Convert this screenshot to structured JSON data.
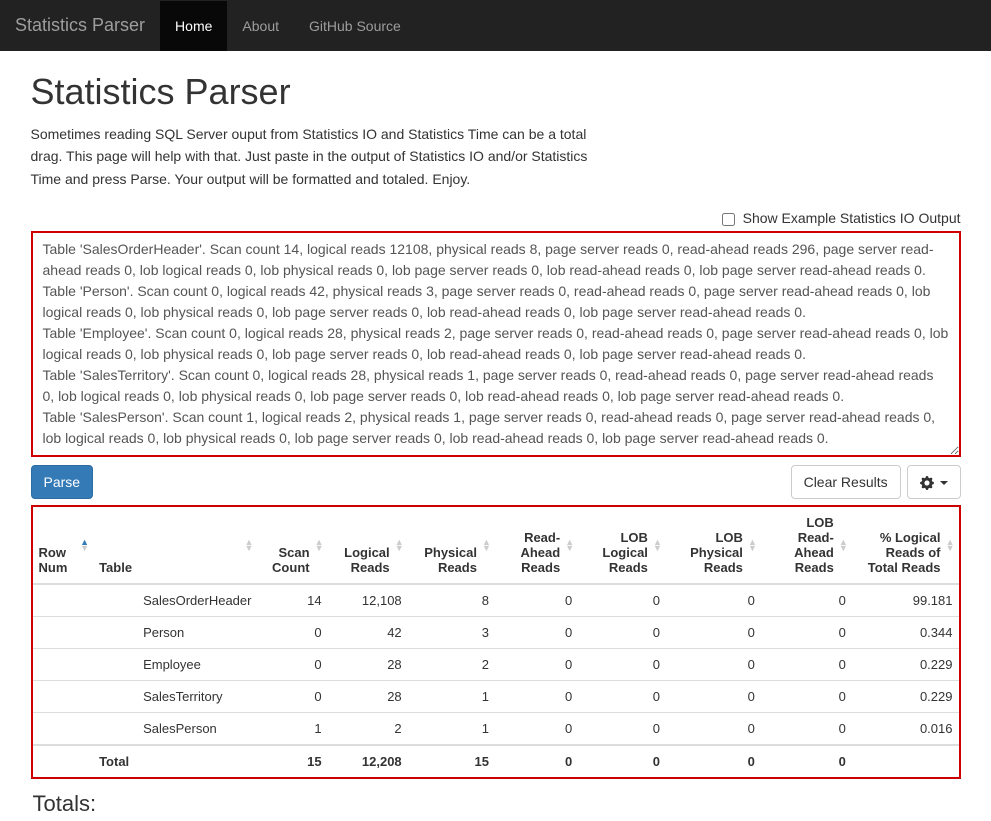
{
  "nav": {
    "brand": "Statistics Parser",
    "items": [
      {
        "label": "Home",
        "active": true
      },
      {
        "label": "About",
        "active": false
      },
      {
        "label": "GitHub Source",
        "active": false
      }
    ]
  },
  "page": {
    "title": "Statistics Parser",
    "intro": "Sometimes reading SQL Server ouput from Statistics IO and Statistics Time can be a total drag. This page will help with that. Just paste in the output of Statistics IO and/or Statistics Time and press Parse. Your output will be formatted and totaled. Enjoy.",
    "show_example_label": "Show Example Statistics IO Output",
    "textarea_value": "Table 'SalesOrderHeader'. Scan count 14, logical reads 12108, physical reads 8, page server reads 0, read-ahead reads 296, page server read-ahead reads 0, lob logical reads 0, lob physical reads 0, lob page server reads 0, lob read-ahead reads 0, lob page server read-ahead reads 0.\nTable 'Person'. Scan count 0, logical reads 42, physical reads 3, page server reads 0, read-ahead reads 0, page server read-ahead reads 0, lob logical reads 0, lob physical reads 0, lob page server reads 0, lob read-ahead reads 0, lob page server read-ahead reads 0.\nTable 'Employee'. Scan count 0, logical reads 28, physical reads 2, page server reads 0, read-ahead reads 0, page server read-ahead reads 0, lob logical reads 0, lob physical reads 0, lob page server reads 0, lob read-ahead reads 0, lob page server read-ahead reads 0.\nTable 'SalesTerritory'. Scan count 0, logical reads 28, physical reads 1, page server reads 0, read-ahead reads 0, page server read-ahead reads 0, lob logical reads 0, lob physical reads 0, lob page server reads 0, lob read-ahead reads 0, lob page server read-ahead reads 0.\nTable 'SalesPerson'. Scan count 1, logical reads 2, physical reads 1, page server reads 0, read-ahead reads 0, page server read-ahead reads 0, lob logical reads 0, lob physical reads 0, lob page server reads 0, lob read-ahead reads 0, lob page server read-ahead reads 0.",
    "parse_label": "Parse",
    "clear_label": "Clear Results",
    "totals_heading": "Totals:"
  },
  "table": {
    "columns": [
      "Row Num",
      "Table",
      "Scan Count",
      "Logical Reads",
      "Physical Reads",
      "Read-Ahead Reads",
      "LOB Logical Reads",
      "LOB Physical Reads",
      "LOB Read-Ahead Reads",
      "% Logical Reads of Total Reads"
    ],
    "rows": [
      {
        "rownum": "",
        "table": "SalesOrderHeader",
        "scan": "14",
        "logical": "12,108",
        "physical": "8",
        "readahead": "0",
        "loblogical": "0",
        "lobphysical": "0",
        "lobreadahead": "0",
        "pct": "99.181"
      },
      {
        "rownum": "",
        "table": "Person",
        "scan": "0",
        "logical": "42",
        "physical": "3",
        "readahead": "0",
        "loblogical": "0",
        "lobphysical": "0",
        "lobreadahead": "0",
        "pct": "0.344"
      },
      {
        "rownum": "",
        "table": "Employee",
        "scan": "0",
        "logical": "28",
        "physical": "2",
        "readahead": "0",
        "loblogical": "0",
        "lobphysical": "0",
        "lobreadahead": "0",
        "pct": "0.229"
      },
      {
        "rownum": "",
        "table": "SalesTerritory",
        "scan": "0",
        "logical": "28",
        "physical": "1",
        "readahead": "0",
        "loblogical": "0",
        "lobphysical": "0",
        "lobreadahead": "0",
        "pct": "0.229"
      },
      {
        "rownum": "",
        "table": "SalesPerson",
        "scan": "1",
        "logical": "2",
        "physical": "1",
        "readahead": "0",
        "loblogical": "0",
        "lobphysical": "0",
        "lobreadahead": "0",
        "pct": "0.016"
      }
    ],
    "total": {
      "rownum": "",
      "table": "Total",
      "scan": "15",
      "logical": "12,208",
      "physical": "15",
      "readahead": "0",
      "loblogical": "0",
      "lobphysical": "0",
      "lobreadahead": "0",
      "pct": ""
    }
  }
}
